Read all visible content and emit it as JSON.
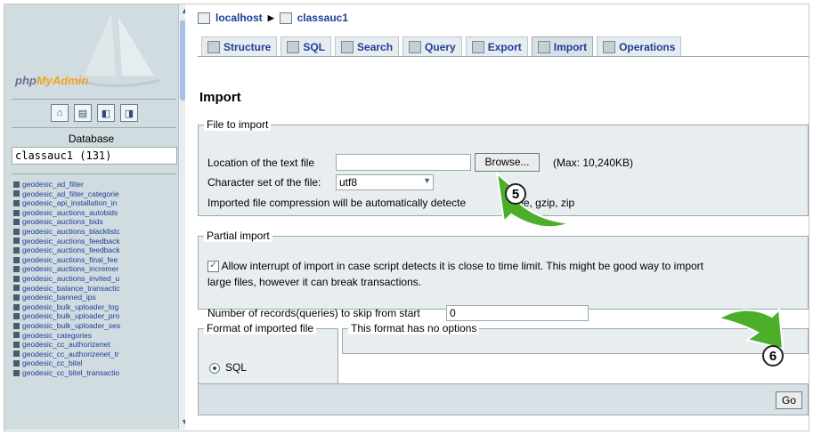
{
  "nav": {
    "logo_php": "php",
    "logo_myadmin": "MyAdmin",
    "icons": [
      "home-icon",
      "sql-window-icon",
      "query-window-icon",
      "docs-icon"
    ],
    "database_label": "Database",
    "database_selected": "classauc1 (131)",
    "tables": [
      "geodesic_ad_filter",
      "geodesic_ad_filter_categorie",
      "geodesic_api_installation_in",
      "geodesic_auctions_autobids",
      "geodesic_auctions_bids",
      "geodesic_auctions_blacklistc",
      "geodesic_auctions_feedback",
      "geodesic_auctions_feedback",
      "geodesic_auctions_final_fee",
      "geodesic_auctions_incremer",
      "geodesic_auctions_invited_u",
      "geodesic_balance_transactic",
      "geodesic_banned_ips",
      "geodesic_bulk_uploader_log",
      "geodesic_bulk_uploader_pro",
      "geodesic_bulk_uploader_ses",
      "geodesic_categories",
      "geodesic_cc_authorizenet",
      "geodesic_cc_authorizenet_tr",
      "geodesic_cc_bitel",
      "geodesic_cc_bitel_transactio"
    ]
  },
  "breadcrumb": {
    "server": "localhost",
    "database": "classauc1"
  },
  "tabs": [
    {
      "label": "Structure",
      "active": false
    },
    {
      "label": "SQL",
      "active": false
    },
    {
      "label": "Search",
      "active": false
    },
    {
      "label": "Query",
      "active": false
    },
    {
      "label": "Export",
      "active": false
    },
    {
      "label": "Import",
      "active": true
    },
    {
      "label": "Operations",
      "active": false
    }
  ],
  "page_title": "Import",
  "file_to_import": {
    "legend": "File to import",
    "location_label": "Location of the text file",
    "location_value": "",
    "browse_label": "Browse...",
    "max_text": "(Max: 10,240KB)",
    "charset_label": "Character set of the file:",
    "charset_value": "utf8",
    "compression_text_a": "Imported file compression will be automatically detecte",
    "compression_text_b": "ne, gzip, zip"
  },
  "partial_import": {
    "legend": "Partial import",
    "allow_interrupt_checked": true,
    "allow_interrupt_label": "Allow interrupt of import in case script detects it is close to time limit. This might be good way to import",
    "allow_interrupt_label_2": "large files, however it can break transactions.",
    "skip_label": "Number of records(queries) to skip from start",
    "skip_value": "0"
  },
  "format": {
    "legend": "Format of imported file",
    "option_sql": "SQL",
    "options_legend": "This format has no options"
  },
  "go_label": "Go",
  "annotations": {
    "step5": "5",
    "step6": "6",
    "arrow_color": "#4caf2a"
  }
}
